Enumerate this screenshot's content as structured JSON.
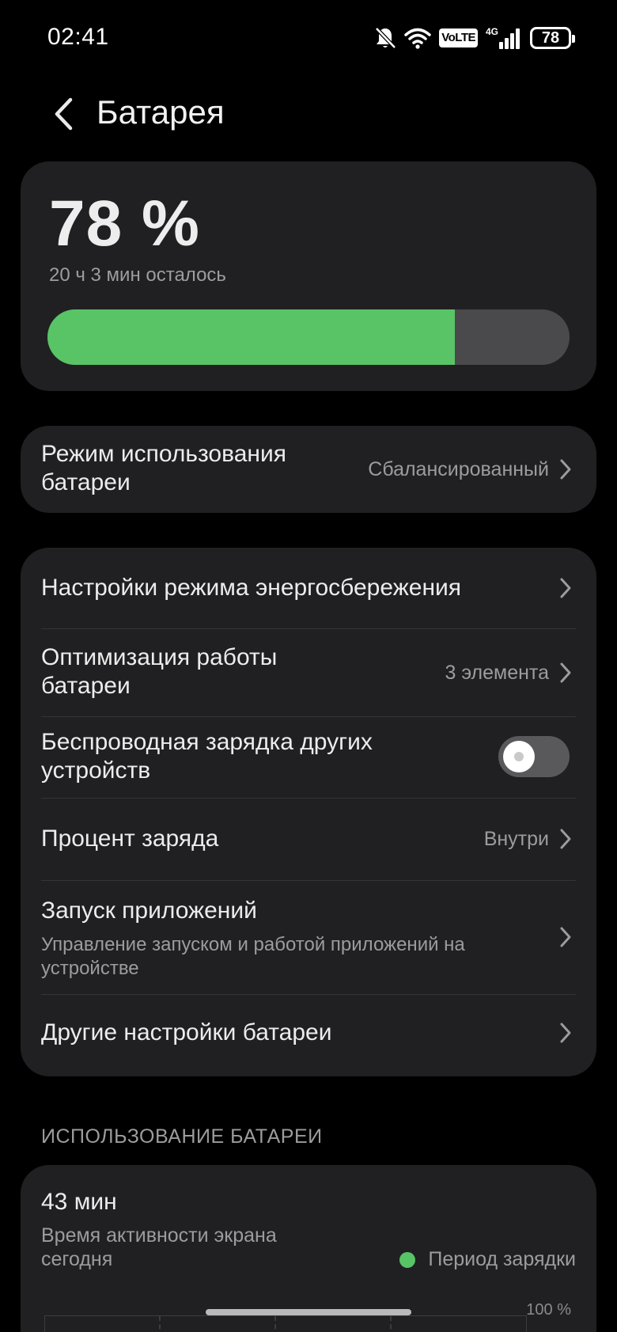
{
  "status_bar": {
    "time": "02:41",
    "volte": "VoLTE",
    "network": "4G",
    "battery": "78"
  },
  "header": {
    "title": "Батарея"
  },
  "battery": {
    "percent_label": "78 %",
    "level": 0.78,
    "remaining": "20 ч 3 мин осталось",
    "fill_color": "#58c466"
  },
  "usage_mode": {
    "title": "Режим использования батареи",
    "value": "Сбалансированный"
  },
  "settings": {
    "power_saving": "Настройки режима энергосбережения",
    "optimization_title": "Оптимизация работы батареи",
    "optimization_value": "3 элемента",
    "wireless_charging": "Беспроводная зарядка других устройств",
    "wireless_charging_on": false,
    "percent_title": "Процент заряда",
    "percent_value": "Внутри",
    "app_launch_title": "Запуск приложений",
    "app_launch_sub": "Управление запуском и работой приложений на устройстве",
    "other": "Другие настройки батареи"
  },
  "usage": {
    "section": "ИСПОЛЬЗОВАНИЕ БАТАРЕИ",
    "screen_time": "43 мин",
    "screen_time_desc": "Время активности экрана сегодня",
    "legend": "Период зарядки",
    "axis_top": "100 %"
  }
}
